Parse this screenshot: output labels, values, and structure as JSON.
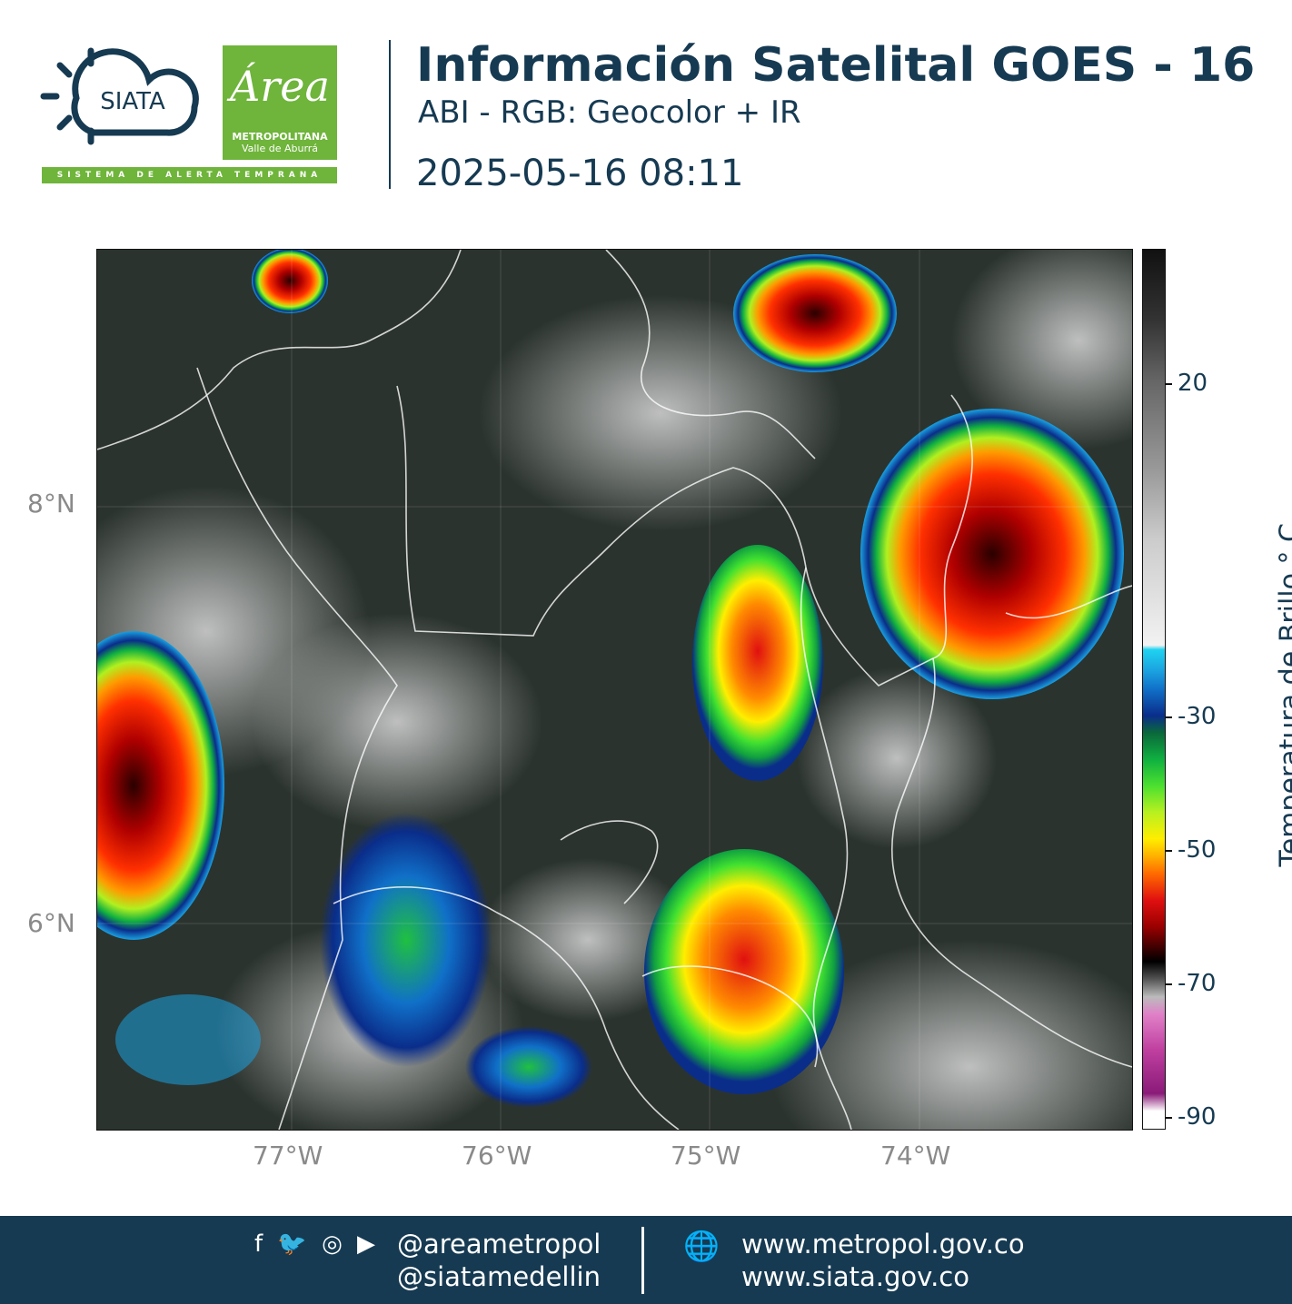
{
  "header": {
    "siata_logo_text": "SIATA",
    "area_logo_script": "Área",
    "area_logo_line1": "METROPOLITANA",
    "area_logo_line2": "Valle de Aburrá",
    "siata_tagline": "SISTEMA DE ALERTA TEMPRANA",
    "title": "Información Satelital GOES - 16",
    "subtitle": "ABI - RGB: Geocolor + IR",
    "datetime": "2025-05-16 08:11"
  },
  "map": {
    "y_ticks": [
      "8°N",
      "6°N"
    ],
    "x_ticks": [
      "77°W",
      "76°W",
      "75°W",
      "74°W"
    ]
  },
  "colorbar": {
    "title": "Temperatura de Brillo ° C",
    "ticks": [
      "20",
      "-30",
      "-50",
      "-70",
      "-90"
    ]
  },
  "footer": {
    "icons": [
      "facebook-icon",
      "twitter-icon",
      "instagram-icon",
      "youtube-icon"
    ],
    "handle1": "@areametropol",
    "handle2": "@siatamedellin",
    "web1": "www.metropol.gov.co",
    "web2": "www.siata.gov.co"
  }
}
